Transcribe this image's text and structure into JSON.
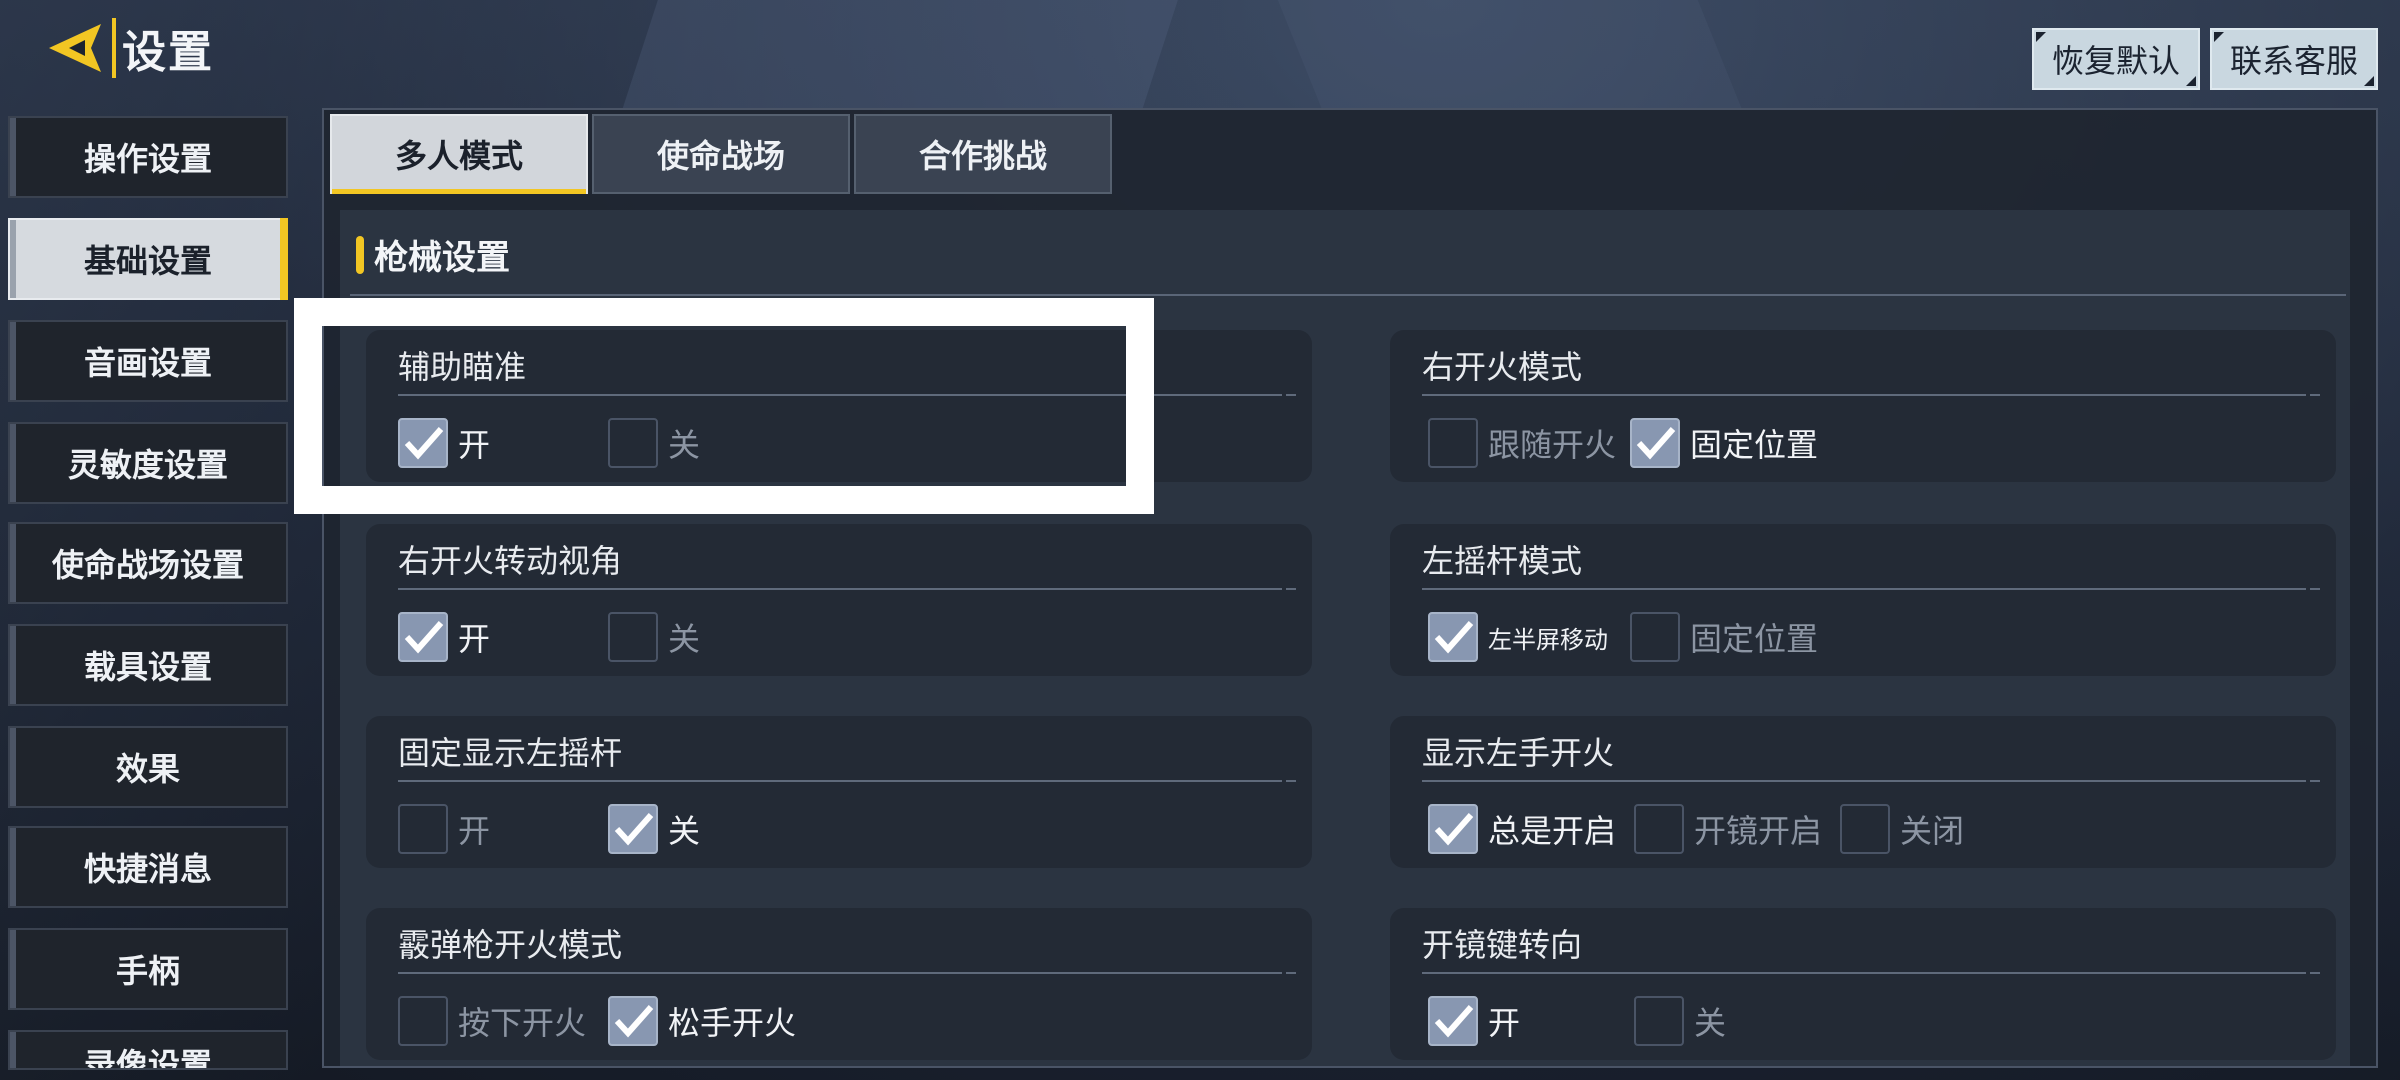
{
  "title": "设置",
  "top_buttons": {
    "restore_default": "恢复默认",
    "contact_support": "联系客服"
  },
  "sidebar": {
    "items": [
      {
        "label": "操作设置"
      },
      {
        "label": "基础设置",
        "active": true
      },
      {
        "label": "音画设置"
      },
      {
        "label": "灵敏度设置"
      },
      {
        "label": "使命战场设置"
      },
      {
        "label": "载具设置"
      },
      {
        "label": "效果"
      },
      {
        "label": "快捷消息"
      },
      {
        "label": "手柄"
      },
      {
        "label": "录像设置"
      }
    ]
  },
  "tabs": [
    {
      "label": "多人模式",
      "active": true
    },
    {
      "label": "使命战场"
    },
    {
      "label": "合作挑战"
    }
  ],
  "section": {
    "title": "枪械设置"
  },
  "settings": {
    "aim_assist": {
      "title": "辅助瞄准",
      "options": [
        {
          "label": "开",
          "checked": true
        },
        {
          "label": "关",
          "checked": false
        }
      ]
    },
    "right_fire_mode": {
      "title": "右开火模式",
      "options": [
        {
          "label": "跟随开火",
          "checked": false
        },
        {
          "label": "固定位置",
          "checked": true
        }
      ]
    },
    "right_fire_rotate": {
      "title": "右开火转动视角",
      "options": [
        {
          "label": "开",
          "checked": true
        },
        {
          "label": "关",
          "checked": false
        }
      ]
    },
    "left_stick_mode": {
      "title": "左摇杆模式",
      "options": [
        {
          "label": "左半屏移动",
          "checked": true
        },
        {
          "label": "固定位置",
          "checked": false
        }
      ]
    },
    "fixed_left_stick": {
      "title": "固定显示左摇杆",
      "options": [
        {
          "label": "开",
          "checked": false
        },
        {
          "label": "关",
          "checked": true
        }
      ]
    },
    "left_hand_fire": {
      "title": "显示左手开火",
      "options": [
        {
          "label": "总是开启",
          "checked": true
        },
        {
          "label": "开镜开启",
          "checked": false
        },
        {
          "label": "关闭",
          "checked": false
        }
      ]
    },
    "shotgun_fire_mode": {
      "title": "霰弹枪开火模式",
      "options": [
        {
          "label": "按下开火",
          "checked": false
        },
        {
          "label": "松手开火",
          "checked": true
        }
      ]
    },
    "scope_turn": {
      "title": "开镜键转向",
      "options": [
        {
          "label": "开",
          "checked": true
        },
        {
          "label": "关",
          "checked": false
        }
      ]
    }
  },
  "colors": {
    "accent": "#f2c623",
    "checked": "#8897b1",
    "highlight": "#ffffff"
  }
}
